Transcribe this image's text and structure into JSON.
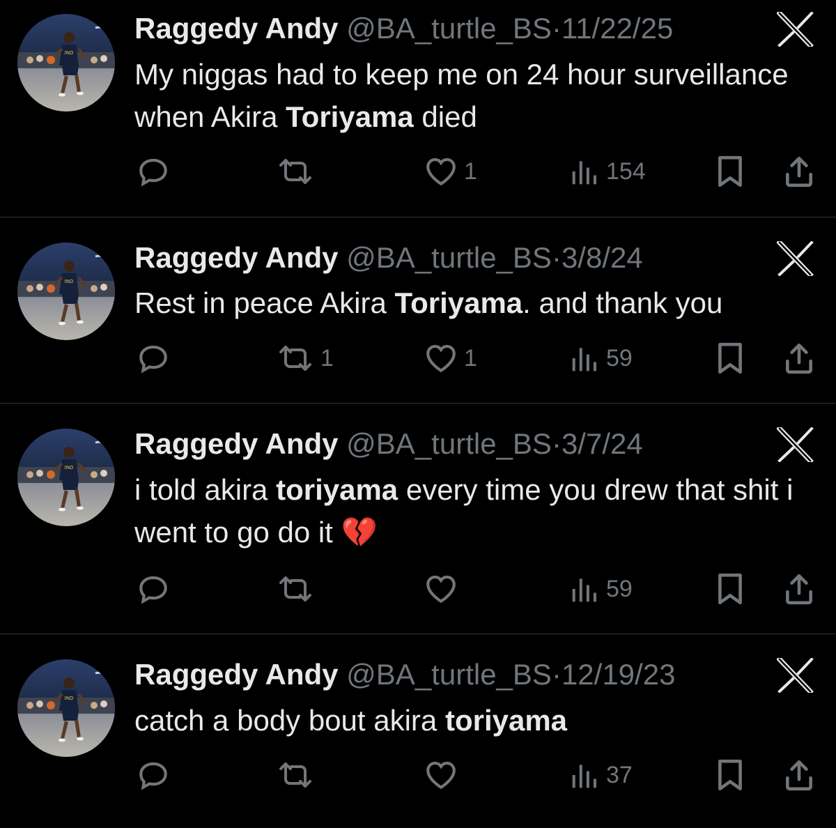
{
  "tweets": [
    {
      "name": "Raggedy Andy",
      "handle": "@BA_turtle_BS",
      "separator": "·",
      "date": "11/22/25",
      "text_parts": [
        {
          "text": "My niggas had to keep me on 24 hour surveillance when Akira ",
          "bold": false
        },
        {
          "text": "Toriyama",
          "bold": true
        },
        {
          "text": " died",
          "bold": false
        }
      ],
      "stats": {
        "replies": "",
        "reposts": "",
        "likes": "1",
        "views": "154"
      }
    },
    {
      "name": "Raggedy Andy",
      "handle": "@BA_turtle_BS",
      "separator": "·",
      "date": "3/8/24",
      "text_parts": [
        {
          "text": "Rest in peace Akira ",
          "bold": false
        },
        {
          "text": "Toriyama",
          "bold": true
        },
        {
          "text": ". and thank you",
          "bold": false
        }
      ],
      "stats": {
        "replies": "",
        "reposts": "1",
        "likes": "1",
        "views": "59"
      }
    },
    {
      "name": "Raggedy Andy",
      "handle": "@BA_turtle_BS",
      "separator": "·",
      "date": "3/7/24",
      "text_parts": [
        {
          "text": "i told akira ",
          "bold": false
        },
        {
          "text": "toriyama",
          "bold": true
        },
        {
          "text": " every time you drew that shit i went to go do it ",
          "bold": false
        },
        {
          "text": "💔",
          "bold": false
        }
      ],
      "stats": {
        "replies": "",
        "reposts": "",
        "likes": "",
        "views": "59"
      }
    },
    {
      "name": "Raggedy Andy",
      "handle": "@BA_turtle_BS",
      "separator": "·",
      "date": "12/19/23",
      "text_parts": [
        {
          "text": "catch a body bout akira ",
          "bold": false
        },
        {
          "text": "toriyama",
          "bold": true
        }
      ],
      "stats": {
        "replies": "",
        "reposts": "",
        "likes": "",
        "views": "37"
      }
    }
  ],
  "icons": {
    "reply": "reply-icon",
    "repost": "repost-icon",
    "like": "heart-icon",
    "views": "views-icon",
    "bookmark": "bookmark-icon",
    "share": "share-icon",
    "brand": "x-logo-icon"
  },
  "colors": {
    "background": "#000000",
    "text": "#e7e9ea",
    "muted": "#71767b",
    "divider": "#2f3336"
  }
}
